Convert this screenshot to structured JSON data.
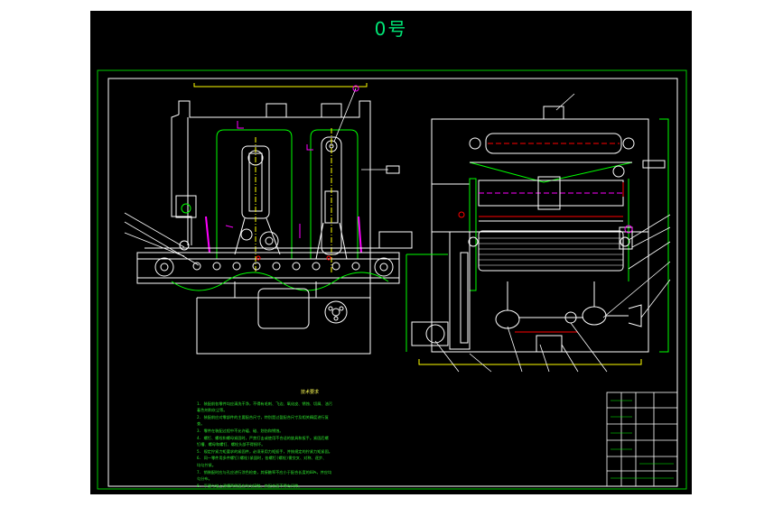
{
  "sheet": {
    "size_label": "0号"
  },
  "colors": {
    "background": "#000000",
    "frame": "#00cc00",
    "outline": "#ffffff",
    "machine": "#00ff00",
    "dimension": "#ffff00",
    "hatch": "#ff00ff",
    "callout": "#00ffff",
    "accent": "#ff0000"
  },
  "notes": {
    "heading": "技术要求",
    "lines": [
      "1. 装配前各零件均应清洗干净，不得有毛刺、飞边、氧化皮、锈蚀、切屑、油污",
      "   着色剂和灰尘等。",
      "2. 装配前应对零部件的主要配合尺寸，特别是过盈配合尺寸及相关精度进行复",
      "   查。",
      "3. 零件在装配过程中不允许磕、碰、划伤和锈蚀。",
      "4. 螺钉、螺栓和螺母紧固时，严禁打击或使用不合适的旋具和扳手。紧固后螺",
      "   钉槽、螺母和螺钉、螺栓头部不得损坏。",
      "5. 规定拧紧力矩要求的紧固件，必须采用力矩扳手，并按规定的拧紧力矩紧固。",
      "6. 同一零件用多件螺钉(螺栓)紧固时，各螺钉(螺栓)需交叉、对称、逐步、",
      "   均匀拧紧。",
      "7. 销装配时应与孔应进行涂色检查，其接触率不应小于配合长度的60%，并应均",
      "   匀分布。",
      "8. 平键与轴上键槽两侧面应均匀接触，其配合面不得有间隙。"
    ]
  }
}
